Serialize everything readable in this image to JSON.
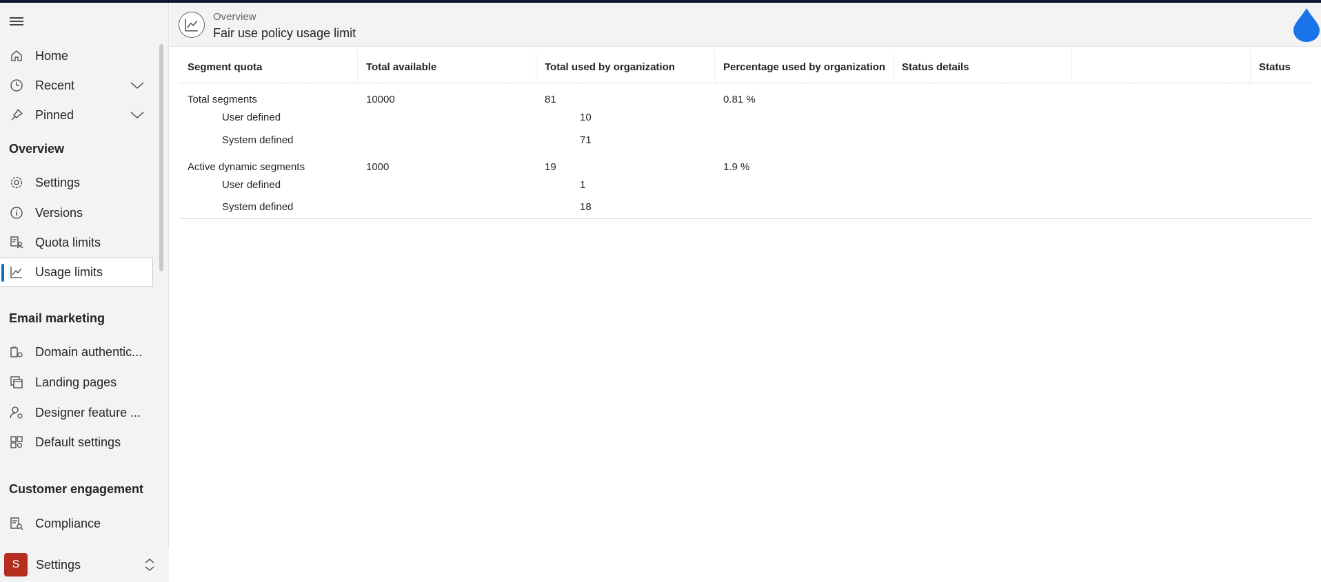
{
  "sidebar": {
    "items": [
      {
        "label": "Home"
      },
      {
        "label": "Recent"
      },
      {
        "label": "Pinned"
      }
    ],
    "sections": [
      {
        "title": "Overview",
        "items": [
          {
            "label": "Settings"
          },
          {
            "label": "Versions"
          },
          {
            "label": "Quota limits"
          },
          {
            "label": "Usage limits"
          }
        ]
      },
      {
        "title": "Email marketing",
        "items": [
          {
            "label": "Domain authentic..."
          },
          {
            "label": "Landing pages"
          },
          {
            "label": "Designer feature ..."
          },
          {
            "label": "Default settings"
          }
        ]
      },
      {
        "title": "Customer engagement",
        "items": [
          {
            "label": "Compliance"
          }
        ]
      }
    ],
    "area": {
      "badge": "S",
      "label": "Settings"
    }
  },
  "header": {
    "breadcrumb": "Overview",
    "title": "Fair use policy usage limit"
  },
  "table": {
    "columns": [
      "Segment quota",
      "Total available",
      "Total used by organization",
      "Percentage used by organization",
      "Status details",
      "Status"
    ],
    "rows": [
      {
        "segment": "Total segments",
        "available": "10000",
        "used": "81",
        "pct": "0.81 %"
      },
      {
        "segment": "User defined",
        "used": "10"
      },
      {
        "segment": "System defined",
        "used": "71"
      },
      {
        "segment": "Active dynamic segments",
        "available": "1000",
        "used": "19",
        "pct": "1.9 %"
      },
      {
        "segment": "User defined",
        "used": "1"
      },
      {
        "segment": "System defined",
        "used": "18"
      }
    ]
  },
  "colors": {
    "accent": "#0f6cbd",
    "area_badge": "#b52e1f",
    "drop": "#1a73e8"
  }
}
